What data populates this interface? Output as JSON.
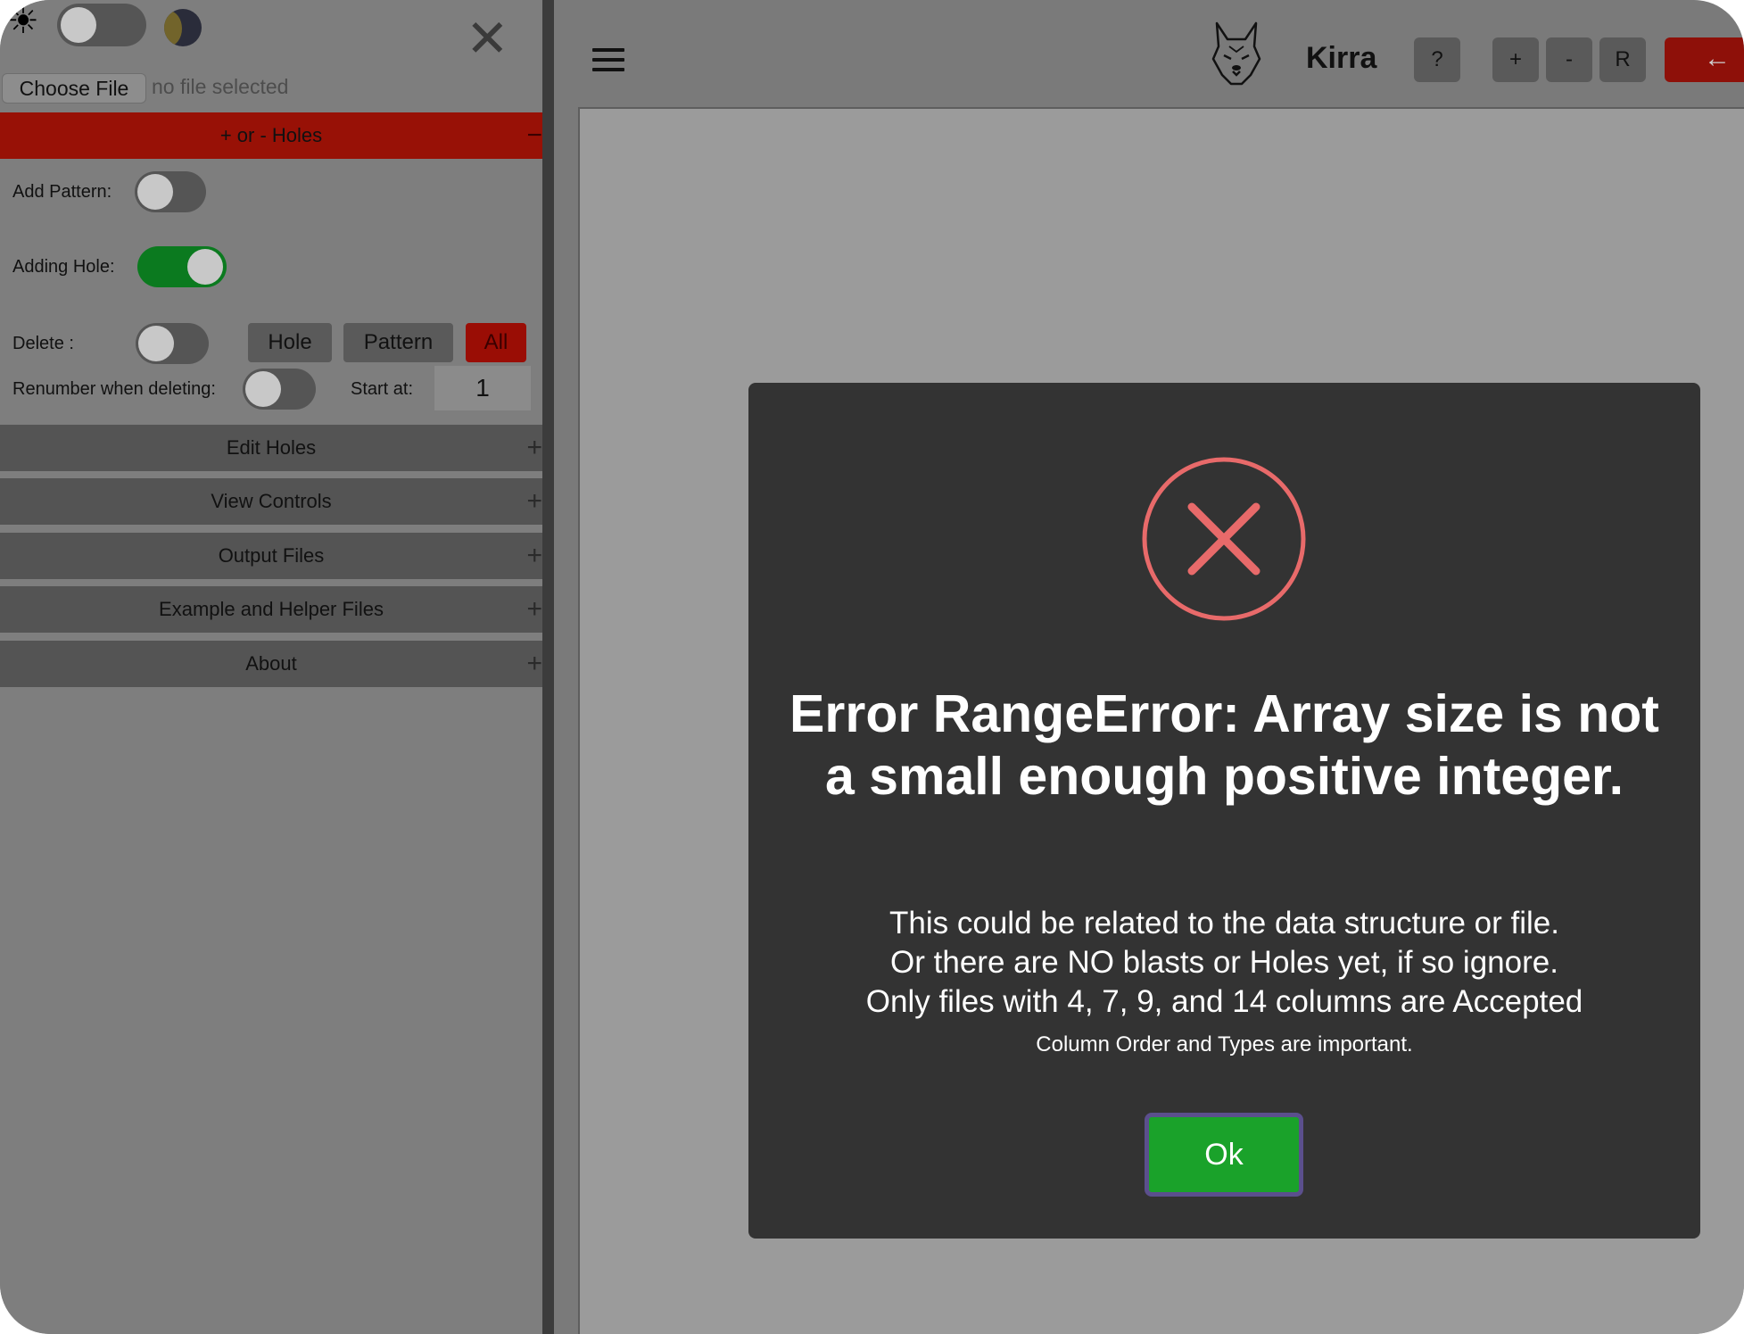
{
  "sidebar": {
    "theme_toggle": {
      "light_icon": "sun-icon",
      "dark_icon": "moon-icon",
      "on": false
    },
    "close_icon": "close-icon",
    "file_input": {
      "button_label": "Choose File",
      "status": "no file selected"
    },
    "holes_section": {
      "title": "+ or - Holes",
      "sign": "−",
      "add_pattern": {
        "label": "Add Pattern:",
        "on": false
      },
      "adding_hole": {
        "label": "Adding Hole:",
        "on": true
      },
      "delete": {
        "label": "Delete :",
        "on": false,
        "buttons": [
          "Hole",
          "Pattern",
          "All"
        ]
      },
      "renumber": {
        "label": "Renumber when deleting:",
        "on": false
      },
      "start_at": {
        "label": "Start at:",
        "value": "1"
      }
    },
    "accordions": [
      {
        "label": "Edit Holes",
        "sign": "+"
      },
      {
        "label": "View Controls",
        "sign": "+"
      },
      {
        "label": "Output Files",
        "sign": "+"
      },
      {
        "label": "Example and Helper Files",
        "sign": "+"
      },
      {
        "label": "About",
        "sign": "+"
      }
    ]
  },
  "topbar": {
    "menu_icon": "hamburger-menu-icon",
    "logo_icon": "dog-logo-icon",
    "brand": "Kirra",
    "buttons": [
      "?",
      "+",
      "-",
      "R"
    ],
    "back_button": "←"
  },
  "modal": {
    "icon": "error-x-circle-icon",
    "title": "Error RangeError: Array size is not a small enough positive integer.",
    "body": [
      "This could be related to the data structure or file.",
      "Or there are NO blasts or Holes yet, if so ignore.",
      "Only files with 4, 7, 9, and 14 columns are Accepted"
    ],
    "note": "Column Order and Types are important.",
    "ok_label": "Ok"
  },
  "colors": {
    "accent_red": "#981106",
    "ok_green": "#1aa22a",
    "error_icon": "#e86a6a",
    "toggle_on": "#0b7a1f",
    "modal_bg": "#333333"
  }
}
